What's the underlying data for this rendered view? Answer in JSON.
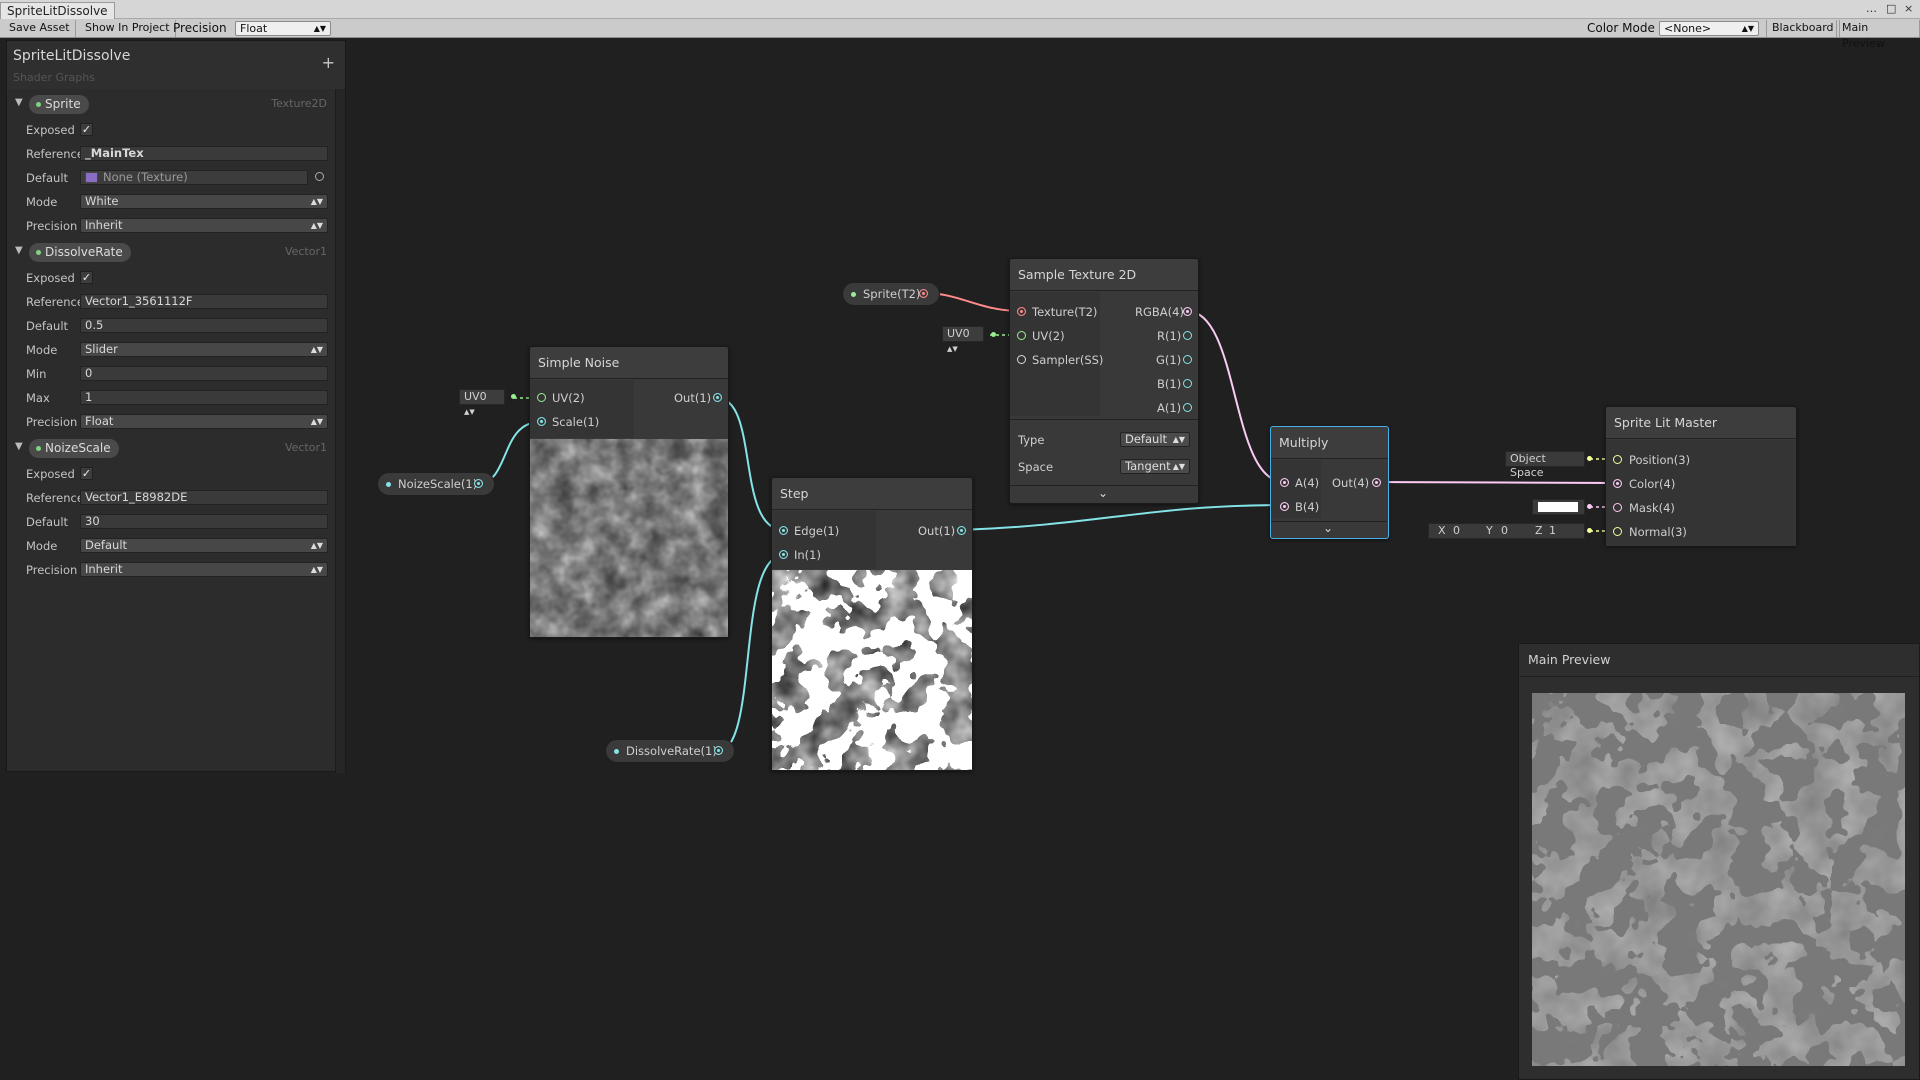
{
  "window": {
    "title": "SpriteLitDissolve",
    "controls": [
      "…",
      "□",
      "×"
    ]
  },
  "toolbar": {
    "save_asset": "Save Asset",
    "show_in_project": "Show In Project",
    "precision_label": "Precision",
    "precision_value": "Float",
    "color_mode_label": "Color Mode",
    "color_mode_value": "<None>",
    "blackboard": "Blackboard",
    "main_preview": "Main Preview"
  },
  "blackboard": {
    "title": "SpriteLitDissolve",
    "subtitle": "Shader Graphs",
    "add": "+",
    "properties": [
      {
        "name": "Sprite",
        "type": "Texture2D",
        "rows": [
          {
            "label": "Exposed",
            "kind": "checkbox",
            "value": "✓"
          },
          {
            "label": "Reference",
            "kind": "field",
            "value": "_MainTex"
          },
          {
            "label": "Default",
            "kind": "texture",
            "value": "None (Texture)"
          },
          {
            "label": "Mode",
            "kind": "dropdown",
            "value": "White"
          },
          {
            "label": "Precision",
            "kind": "dropdown",
            "value": "Inherit"
          }
        ]
      },
      {
        "name": "DissolveRate",
        "type": "Vector1",
        "rows": [
          {
            "label": "Exposed",
            "kind": "checkbox",
            "value": "✓"
          },
          {
            "label": "Reference",
            "kind": "field",
            "value": "Vector1_3561112F"
          },
          {
            "label": "Default",
            "kind": "field",
            "value": "0.5"
          },
          {
            "label": "Mode",
            "kind": "dropdown",
            "value": "Slider"
          },
          {
            "label": "Min",
            "kind": "field",
            "value": "0"
          },
          {
            "label": "Max",
            "kind": "field",
            "value": "1"
          },
          {
            "label": "Precision",
            "kind": "dropdown",
            "value": "Float"
          }
        ]
      },
      {
        "name": "NoizeScale",
        "type": "Vector1",
        "rows": [
          {
            "label": "Exposed",
            "kind": "checkbox",
            "value": "✓"
          },
          {
            "label": "Reference",
            "kind": "field",
            "value": "Vector1_E8982DE"
          },
          {
            "label": "Default",
            "kind": "field",
            "value": "30"
          },
          {
            "label": "Mode",
            "kind": "dropdown",
            "value": "Default"
          },
          {
            "label": "Precision",
            "kind": "dropdown",
            "value": "Inherit"
          }
        ]
      }
    ]
  },
  "nodes": {
    "simple_noise": {
      "title": "Simple Noise",
      "uv": "UV(2)",
      "scale": "Scale(1)",
      "out": "Out(1)",
      "uv_input": "UV0"
    },
    "noize_param": {
      "label": "NoizeScale(1)"
    },
    "step": {
      "title": "Step",
      "edge": "Edge(1)",
      "in": "In(1)",
      "out": "Out(1)"
    },
    "dissolve_param": {
      "label": "DissolveRate(1)"
    },
    "sprite_param": {
      "label": "Sprite(T2)"
    },
    "sample_texture": {
      "title": "Sample Texture 2D",
      "texture": "Texture(T2)",
      "uv": "UV(2)",
      "sampler": "Sampler(SS)",
      "rgba": "RGBA(4)",
      "r": "R(1)",
      "g": "G(1)",
      "b": "B(1)",
      "a": "A(1)",
      "uv_input": "UV0",
      "type_label": "Type",
      "type_value": "Default",
      "space_label": "Space",
      "space_value": "Tangent"
    },
    "multiply": {
      "title": "Multiply",
      "a": "A(4)",
      "b": "B(4)",
      "out": "Out(4)"
    },
    "master": {
      "title": "Sprite Lit Master",
      "position": "Position(3)",
      "color": "Color(4)",
      "mask": "Mask(4)",
      "normal": "Normal(3)",
      "position_input": "Object Space",
      "normal_x_label": "X",
      "normal_x": "0",
      "normal_y_label": "Y",
      "normal_y": "0",
      "normal_z_label": "Z",
      "normal_z": "1"
    }
  },
  "main_preview": {
    "title": "Main Preview"
  },
  "colors": {
    "vector1": "#84e4e7",
    "vector2": "#9aef92",
    "vector3": "#f6ff9a",
    "vector4": "#fbcbf4",
    "texture": "#ff8b8b",
    "sampler": "#dcdcdc",
    "selection": "#44b0e6"
  }
}
